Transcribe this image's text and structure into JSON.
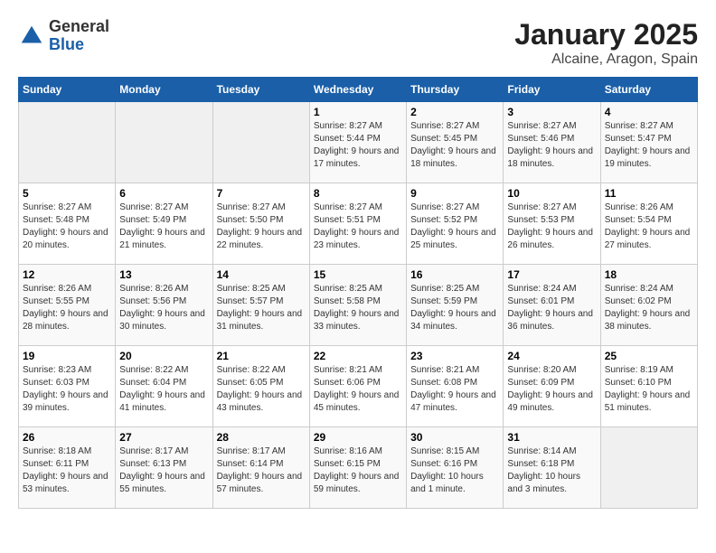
{
  "header": {
    "logo_general": "General",
    "logo_blue": "Blue",
    "title": "January 2025",
    "subtitle": "Alcaine, Aragon, Spain"
  },
  "days_of_week": [
    "Sunday",
    "Monday",
    "Tuesday",
    "Wednesday",
    "Thursday",
    "Friday",
    "Saturday"
  ],
  "weeks": [
    {
      "days": [
        {
          "number": "",
          "info": ""
        },
        {
          "number": "",
          "info": ""
        },
        {
          "number": "",
          "info": ""
        },
        {
          "number": "1",
          "info": "Sunrise: 8:27 AM\nSunset: 5:44 PM\nDaylight: 9 hours\nand 17 minutes."
        },
        {
          "number": "2",
          "info": "Sunrise: 8:27 AM\nSunset: 5:45 PM\nDaylight: 9 hours\nand 18 minutes."
        },
        {
          "number": "3",
          "info": "Sunrise: 8:27 AM\nSunset: 5:46 PM\nDaylight: 9 hours\nand 18 minutes."
        },
        {
          "number": "4",
          "info": "Sunrise: 8:27 AM\nSunset: 5:47 PM\nDaylight: 9 hours\nand 19 minutes."
        }
      ]
    },
    {
      "days": [
        {
          "number": "5",
          "info": "Sunrise: 8:27 AM\nSunset: 5:48 PM\nDaylight: 9 hours\nand 20 minutes."
        },
        {
          "number": "6",
          "info": "Sunrise: 8:27 AM\nSunset: 5:49 PM\nDaylight: 9 hours\nand 21 minutes."
        },
        {
          "number": "7",
          "info": "Sunrise: 8:27 AM\nSunset: 5:50 PM\nDaylight: 9 hours\nand 22 minutes."
        },
        {
          "number": "8",
          "info": "Sunrise: 8:27 AM\nSunset: 5:51 PM\nDaylight: 9 hours\nand 23 minutes."
        },
        {
          "number": "9",
          "info": "Sunrise: 8:27 AM\nSunset: 5:52 PM\nDaylight: 9 hours\nand 25 minutes."
        },
        {
          "number": "10",
          "info": "Sunrise: 8:27 AM\nSunset: 5:53 PM\nDaylight: 9 hours\nand 26 minutes."
        },
        {
          "number": "11",
          "info": "Sunrise: 8:26 AM\nSunset: 5:54 PM\nDaylight: 9 hours\nand 27 minutes."
        }
      ]
    },
    {
      "days": [
        {
          "number": "12",
          "info": "Sunrise: 8:26 AM\nSunset: 5:55 PM\nDaylight: 9 hours\nand 28 minutes."
        },
        {
          "number": "13",
          "info": "Sunrise: 8:26 AM\nSunset: 5:56 PM\nDaylight: 9 hours\nand 30 minutes."
        },
        {
          "number": "14",
          "info": "Sunrise: 8:25 AM\nSunset: 5:57 PM\nDaylight: 9 hours\nand 31 minutes."
        },
        {
          "number": "15",
          "info": "Sunrise: 8:25 AM\nSunset: 5:58 PM\nDaylight: 9 hours\nand 33 minutes."
        },
        {
          "number": "16",
          "info": "Sunrise: 8:25 AM\nSunset: 5:59 PM\nDaylight: 9 hours\nand 34 minutes."
        },
        {
          "number": "17",
          "info": "Sunrise: 8:24 AM\nSunset: 6:01 PM\nDaylight: 9 hours\nand 36 minutes."
        },
        {
          "number": "18",
          "info": "Sunrise: 8:24 AM\nSunset: 6:02 PM\nDaylight: 9 hours\nand 38 minutes."
        }
      ]
    },
    {
      "days": [
        {
          "number": "19",
          "info": "Sunrise: 8:23 AM\nSunset: 6:03 PM\nDaylight: 9 hours\nand 39 minutes."
        },
        {
          "number": "20",
          "info": "Sunrise: 8:22 AM\nSunset: 6:04 PM\nDaylight: 9 hours\nand 41 minutes."
        },
        {
          "number": "21",
          "info": "Sunrise: 8:22 AM\nSunset: 6:05 PM\nDaylight: 9 hours\nand 43 minutes."
        },
        {
          "number": "22",
          "info": "Sunrise: 8:21 AM\nSunset: 6:06 PM\nDaylight: 9 hours\nand 45 minutes."
        },
        {
          "number": "23",
          "info": "Sunrise: 8:21 AM\nSunset: 6:08 PM\nDaylight: 9 hours\nand 47 minutes."
        },
        {
          "number": "24",
          "info": "Sunrise: 8:20 AM\nSunset: 6:09 PM\nDaylight: 9 hours\nand 49 minutes."
        },
        {
          "number": "25",
          "info": "Sunrise: 8:19 AM\nSunset: 6:10 PM\nDaylight: 9 hours\nand 51 minutes."
        }
      ]
    },
    {
      "days": [
        {
          "number": "26",
          "info": "Sunrise: 8:18 AM\nSunset: 6:11 PM\nDaylight: 9 hours\nand 53 minutes."
        },
        {
          "number": "27",
          "info": "Sunrise: 8:17 AM\nSunset: 6:13 PM\nDaylight: 9 hours\nand 55 minutes."
        },
        {
          "number": "28",
          "info": "Sunrise: 8:17 AM\nSunset: 6:14 PM\nDaylight: 9 hours\nand 57 minutes."
        },
        {
          "number": "29",
          "info": "Sunrise: 8:16 AM\nSunset: 6:15 PM\nDaylight: 9 hours\nand 59 minutes."
        },
        {
          "number": "30",
          "info": "Sunrise: 8:15 AM\nSunset: 6:16 PM\nDaylight: 10 hours\nand 1 minute."
        },
        {
          "number": "31",
          "info": "Sunrise: 8:14 AM\nSunset: 6:18 PM\nDaylight: 10 hours\nand 3 minutes."
        },
        {
          "number": "",
          "info": ""
        }
      ]
    }
  ]
}
